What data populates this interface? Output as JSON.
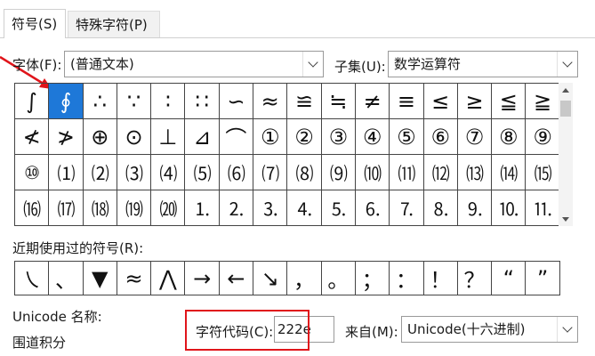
{
  "tabs": [
    {
      "label": "符号(S)"
    },
    {
      "label": "特殊字符(P)"
    }
  ],
  "font": {
    "label": "字体(F):",
    "value": "(普通文本)"
  },
  "subset": {
    "label": "子集(U):",
    "value": "数学运算符"
  },
  "symbols": [
    [
      "∫",
      "∮",
      "∴",
      "∵",
      "∶",
      "∷",
      "∽",
      "≈",
      "≌",
      "≒",
      "≠",
      "≡",
      "≤",
      "≥",
      "≦",
      "≧"
    ],
    [
      "≮",
      "≯",
      "⊕",
      "⊙",
      "⊥",
      "⊿",
      "⌒",
      "①",
      "②",
      "③",
      "④",
      "⑤",
      "⑥",
      "⑦",
      "⑧",
      "⑨"
    ],
    [
      "⑩",
      "⑴",
      "⑵",
      "⑶",
      "⑷",
      "⑸",
      "⑹",
      "⑺",
      "⑻",
      "⑼",
      "⑽",
      "⑾",
      "⑿",
      "⒀",
      "⒁",
      "⒂"
    ],
    [
      "⒃",
      "⒄",
      "⒅",
      "⒆",
      "⒇",
      "⒈",
      "⒉",
      "⒊",
      "⒋",
      "⒌",
      "⒍",
      "⒎",
      "⒏",
      "⒐",
      "⒑",
      "⒒"
    ]
  ],
  "selected_symbol": "∮",
  "recent_label": "近期使用过的符号(R):",
  "recent_symbols": [
    "㇏",
    "、",
    "▼",
    "≈",
    "⋀",
    "→",
    "←",
    "↘",
    "，",
    "。",
    "；",
    "：",
    "！",
    "？",
    "“",
    "”"
  ],
  "unicode_name_label": "Unicode 名称:",
  "unicode_name_value": "围道积分",
  "char_code_label": "字符代码(C):",
  "char_code_value": "222e",
  "from_label": "来自(M):",
  "from_value": "Unicode(十六进制)",
  "colors": {
    "selection": "#1e78d8",
    "highlight_box": "#e0151b",
    "arrow": "#e0151b"
  }
}
